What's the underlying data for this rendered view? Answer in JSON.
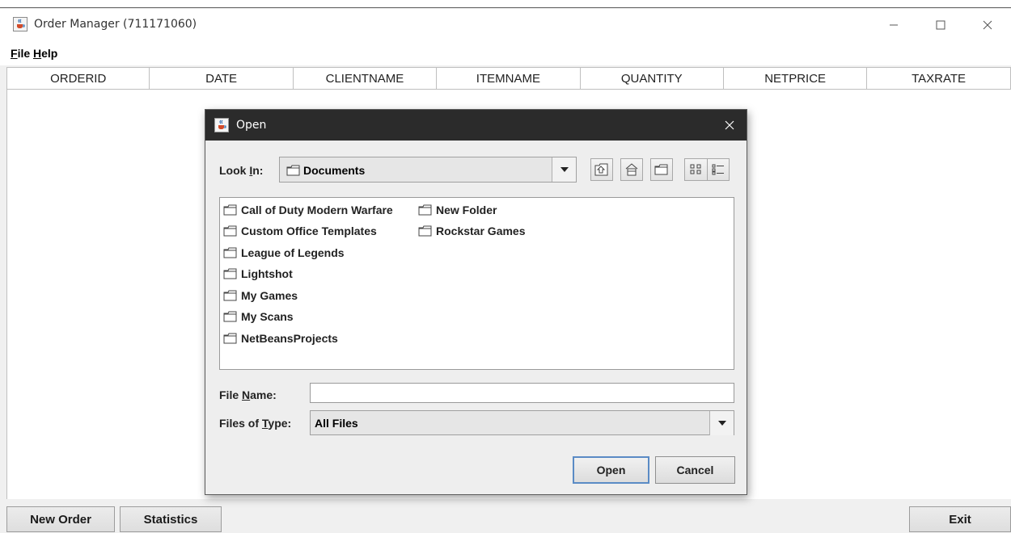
{
  "window": {
    "title": "Order Manager (711171060)",
    "icon": "java-cup-icon"
  },
  "menubar": {
    "file": {
      "mnemonic": "F",
      "rest": "ile"
    },
    "help": {
      "mnemonic": "H",
      "rest": "elp"
    }
  },
  "table": {
    "columns": [
      "ORDERID",
      "DATE",
      "CLIENTNAME",
      "ITEMNAME",
      "QUANTITY",
      "NETPRICE",
      "TAXRATE"
    ],
    "rows": []
  },
  "buttons": {
    "new_order": "New Order",
    "statistics": "Statistics",
    "exit": "Exit"
  },
  "dialog": {
    "title": "Open",
    "look_in": {
      "prefix": "Look ",
      "mnemonic": "I",
      "suffix": "n:",
      "value": "Documents"
    },
    "toolbar": [
      "up-one-level-icon",
      "home-icon",
      "new-folder-icon",
      "list-view-icon",
      "details-view-icon"
    ],
    "files": [
      "Call of Duty Modern Warfare",
      "Custom Office Templates",
      "League of Legends",
      "Lightshot",
      "My Games",
      "My Scans",
      "NetBeansProjects",
      "New Folder",
      "Rockstar Games"
    ],
    "file_name": {
      "prefix": "File ",
      "mnemonic": "N",
      "suffix": "ame:",
      "value": ""
    },
    "files_of_type": {
      "prefix": "Files of ",
      "mnemonic": "T",
      "suffix": "ype:",
      "value": "All Files"
    },
    "open_label": "Open",
    "cancel_label": "Cancel"
  }
}
